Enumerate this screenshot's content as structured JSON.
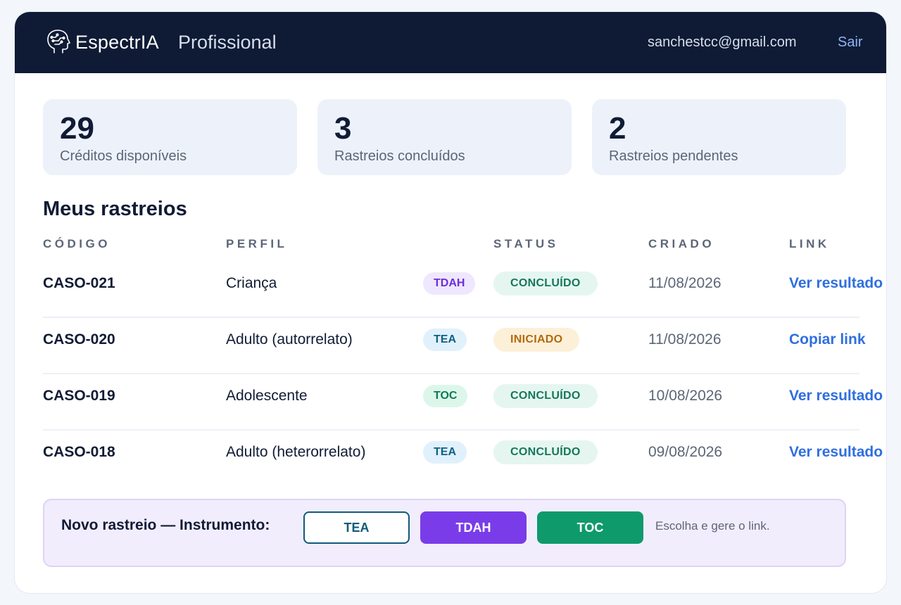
{
  "header": {
    "brand": "EspectrIA",
    "subtitle": "Profissional",
    "email": "sanchestcc@gmail.com",
    "logout_label": "Sair"
  },
  "stats": [
    {
      "value": "29",
      "label": "Créditos disponíveis"
    },
    {
      "value": "3",
      "label": "Rastreios concluídos"
    },
    {
      "value": "2",
      "label": "Rastreios pendentes"
    }
  ],
  "section_title": "Meus rastreios",
  "table": {
    "headers": [
      "CÓDIGO",
      "PERFIL",
      "STATUS",
      "CRIADO",
      "LINK"
    ],
    "rows": [
      {
        "code": "CASO-021",
        "perfil": "Criança",
        "tag": "TDAH",
        "status": "CONCLUÍDO",
        "created": "11/08/2026",
        "link": "Ver resultado"
      },
      {
        "code": "CASO-020",
        "perfil": "Adulto (autorrelato)",
        "tag": "TEA",
        "status": "INICIADO",
        "created": "11/08/2026",
        "link": "Copiar link"
      },
      {
        "code": "CASO-019",
        "perfil": "Adolescente",
        "tag": "TOC",
        "status": "CONCLUÍDO",
        "created": "10/08/2026",
        "link": "Ver resultado"
      },
      {
        "code": "CASO-018",
        "perfil": "Adulto (heterorrelato)",
        "tag": "TEA",
        "status": "CONCLUÍDO",
        "created": "09/08/2026",
        "link": "Ver resultado"
      }
    ]
  },
  "new_screening": {
    "label": "Novo rastreio — Instrumento:",
    "buttons": {
      "tea": "TEA",
      "tdah": "TDAH",
      "toc": "TOC"
    },
    "hint": "Escolha e gere o link."
  },
  "colors": {
    "topbar": "#0f1b35",
    "link": "#2f6fe0",
    "tag_tdah_bg": "#efe7fd",
    "tag_tdah_fg": "#6c2fd6",
    "tag_tea_bg": "#e1f1fb",
    "tag_tea_fg": "#0e5f86",
    "tag_toc_bg": "#dcf7ea",
    "tag_toc_fg": "#0d7a53",
    "status_done_bg": "#e5f6f0",
    "status_done_fg": "#16775a",
    "status_started_bg": "#fdf0d9",
    "status_started_fg": "#b36a0c"
  },
  "icons": {
    "brand_logo": "head-circuit-icon"
  }
}
